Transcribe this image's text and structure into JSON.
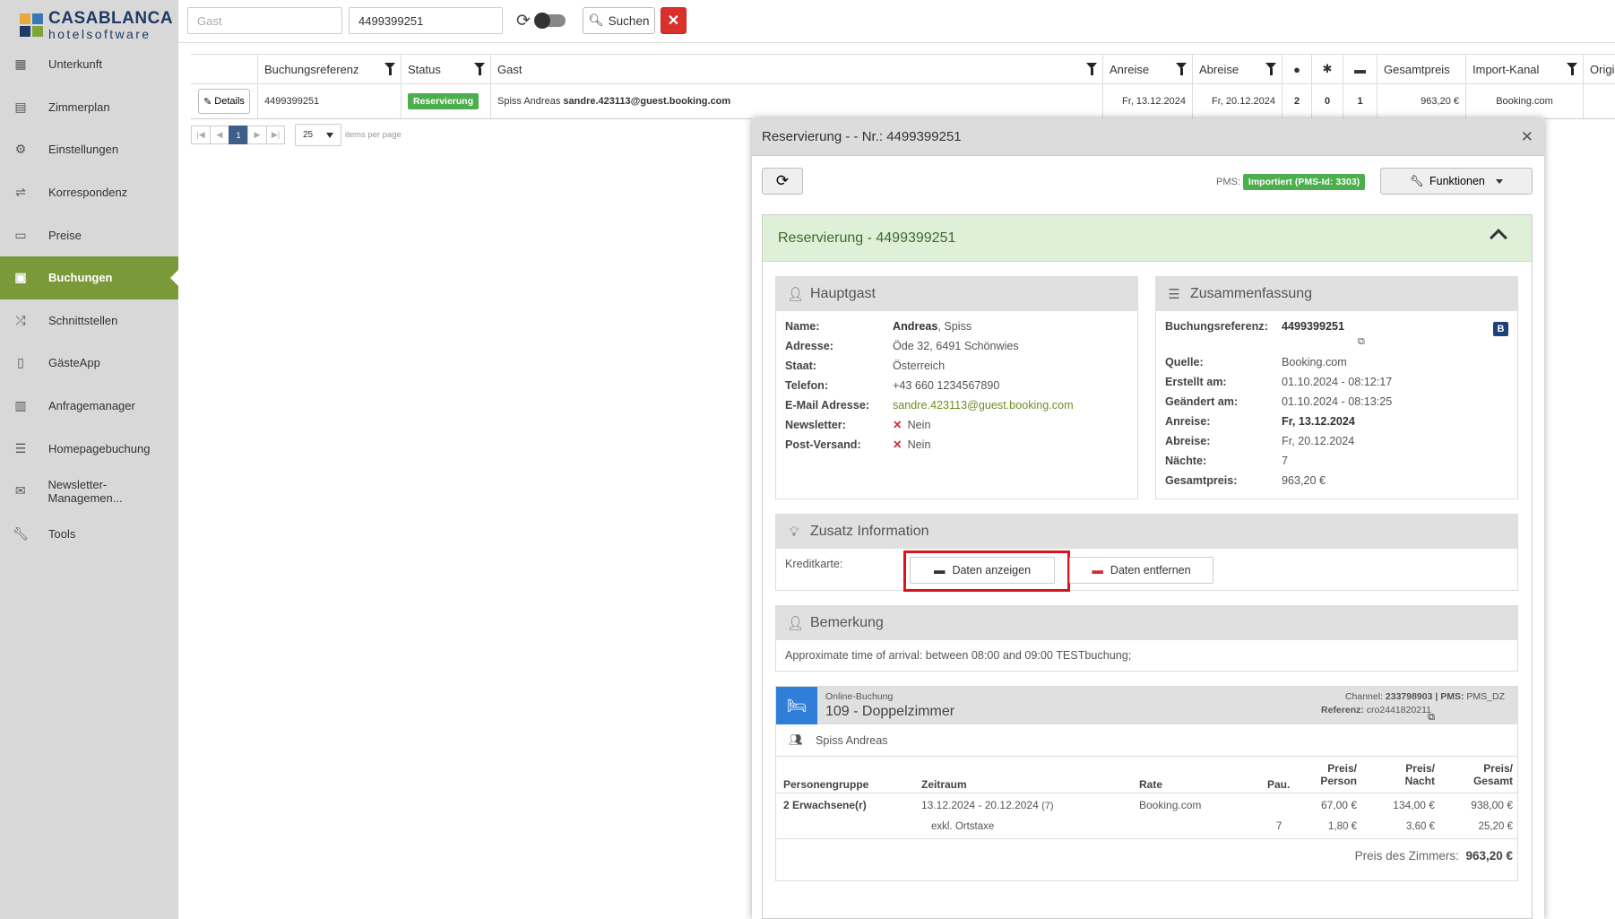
{
  "brand": {
    "line1": "CASABLANCA",
    "line2": "hotelsoftware",
    "colors": [
      "#e8a93a",
      "#3b76b8",
      "#7fa53a",
      "#1f3a64"
    ]
  },
  "sidebar": {
    "items": [
      {
        "label": "Unterkunft",
        "icon": "building-icon"
      },
      {
        "label": "Zimmerplan",
        "icon": "calendar-grid-icon"
      },
      {
        "label": "Einstellungen",
        "icon": "gears-icon"
      },
      {
        "label": "Korrespondenz",
        "icon": "signpost-icon"
      },
      {
        "label": "Preise",
        "icon": "money-icon"
      },
      {
        "label": "Buchungen",
        "icon": "briefcase-icon",
        "active": true
      },
      {
        "label": "Schnittstellen",
        "icon": "shuffle-icon"
      },
      {
        "label": "GästeApp",
        "icon": "mobile-icon"
      },
      {
        "label": "Anfragemanager",
        "icon": "building-list-icon"
      },
      {
        "label": "Homepagebuchung",
        "icon": "list-icon"
      },
      {
        "label": "Newsletter-Managemen...",
        "icon": "envelope-icon"
      },
      {
        "label": "Tools",
        "icon": "wrench-icon"
      }
    ]
  },
  "topbar": {
    "guest_placeholder": "Gast",
    "reference_value": "4499399251",
    "search_label": "Suchen"
  },
  "grid": {
    "columns": [
      "",
      "Buchungsreferenz",
      "Status",
      "Gast",
      "Anreise",
      "Abreise",
      "",
      "",
      "",
      "Gesamtpreis",
      "Import-Kanal",
      "Origi"
    ],
    "row": {
      "details": "Details",
      "reference": "4499399251",
      "status": "Reservierung",
      "guest_name": "Spiss Andreas",
      "guest_email": "sandre.423113@guest.booking.com",
      "arrival": "Fr, 13.12.2024",
      "departure": "Fr, 20.12.2024",
      "adults": "2",
      "children": "0",
      "rooms": "1",
      "total": "963,20 €",
      "channel": "Booking.com"
    },
    "pager": {
      "current": "1",
      "page_size": "25",
      "label": "items per page"
    }
  },
  "modal": {
    "title": "Reservierung - - Nr.: 4499399251",
    "pms_label": "PMS:",
    "pms_badge": "Importiert (PMS-Id: 3303)",
    "functions_label": "Funktionen",
    "section_title": "Reservierung - 4499399251",
    "hauptgast": {
      "title": "Hauptgast",
      "name_label": "Name:",
      "name_first": "Andreas",
      "name_rest": ", Spiss",
      "address_label": "Adresse:",
      "address": "Öde 32, 6491 Schönwies",
      "state_label": "Staat:",
      "state": "Österreich",
      "phone_label": "Telefon:",
      "phone": "+43 660 1234567890",
      "email_label": "E-Mail Adresse:",
      "email": "sandre.423113@guest.booking.com",
      "newsletter_label": "Newsletter:",
      "newsletter": "Nein",
      "post_label": "Post-Versand:",
      "post": "Nein"
    },
    "summary": {
      "title": "Zusammenfassung",
      "ref_label": "Buchungsreferenz:",
      "ref": "4499399251",
      "badge": "B",
      "source_label": "Quelle:",
      "source": "Booking.com",
      "created_label": "Erstellt am:",
      "created": "01.10.2024 - 08:12:17",
      "changed_label": "Geändert am:",
      "changed": "01.10.2024 - 08:13:25",
      "arrival_label": "Anreise:",
      "arrival": "Fr, 13.12.2024",
      "departure_label": "Abreise:",
      "departure": "Fr, 20.12.2024",
      "nights_label": "Nächte:",
      "nights": "7",
      "total_label": "Gesamtpreis:",
      "total": "963,20 €"
    },
    "extra": {
      "title": "Zusatz Information",
      "cc_label": "Kreditkarte:",
      "show_label": "Daten anzeigen",
      "remove_label": "Daten entfernen"
    },
    "remark": {
      "title": "Bemerkung",
      "text": "Approximate time of arrival: between 08:00 and 09:00 TESTbuchung;"
    },
    "room": {
      "kind": "Online-Buchung",
      "name": "109 - Doppelzimmer",
      "channel_label": "Channel:",
      "channel": "233798903",
      "pms_label": "| PMS:",
      "pms": "PMS_DZ",
      "ref_label": "Referenz:",
      "ref": "cro2441820211",
      "guest": "Spiss Andreas",
      "headers": {
        "group": "Personengruppe",
        "period": "Zeitraum",
        "rate": "Rate",
        "pau": "Pau.",
        "pp1": "Preis/",
        "pp2": "Person",
        "pn1": "Preis/",
        "pn2": "Nacht",
        "pt1": "Preis/",
        "pt2": "Gesamt"
      },
      "rows": [
        {
          "group": "2 Erwachsene(r)",
          "period": "13.12.2024 - 20.12.2024",
          "nights": "(7)",
          "rate": "Booking.com",
          "pau": "",
          "pp": "67,00 €",
          "pn": "134,00 €",
          "pt": "938,00 €"
        },
        {
          "group": "",
          "period": "exkl. Ortstaxe",
          "nights": "",
          "rate": "",
          "pau": "7",
          "pp": "1,80 €",
          "pn": "3,60 €",
          "pt": "25,20 €"
        }
      ],
      "total_label": "Preis des Zimmers:",
      "total": "963,20 €"
    }
  }
}
